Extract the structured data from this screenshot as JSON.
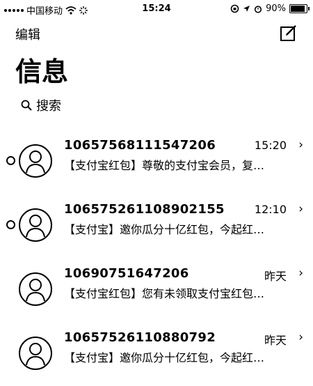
{
  "status_bar": {
    "carrier": "中国移动",
    "time": "15:24",
    "battery": "90%",
    "battery_level": 0.9,
    "icons": [
      "signal-icon",
      "wifi-icon",
      "loading-icon",
      "lock-rotation-icon",
      "location-icon",
      "alarm-icon",
      "battery-icon"
    ]
  },
  "nav": {
    "edit_label": "编辑",
    "compose_icon": "compose-icon"
  },
  "title": "信息",
  "search": {
    "placeholder": "搜索",
    "icon": "search-icon"
  },
  "conversations": [
    {
      "sender": "10657568111547206",
      "time": "15:20",
      "preview": "【支付宝红包】尊敬的支付宝会员，复…",
      "unread": true
    },
    {
      "sender": "106575261108902155",
      "time": "12:10",
      "preview": "【支付宝】邀你瓜分十亿红包，今起红…",
      "unread": true
    },
    {
      "sender": "10690751647206",
      "time": "昨天",
      "preview": "【支付宝红包】您有未领取支付宝红包…",
      "unread": false
    },
    {
      "sender": "10657526110880792",
      "time": "昨天",
      "preview": "【支付宝】邀你瓜分十亿红包，今起红…",
      "unread": false
    }
  ]
}
